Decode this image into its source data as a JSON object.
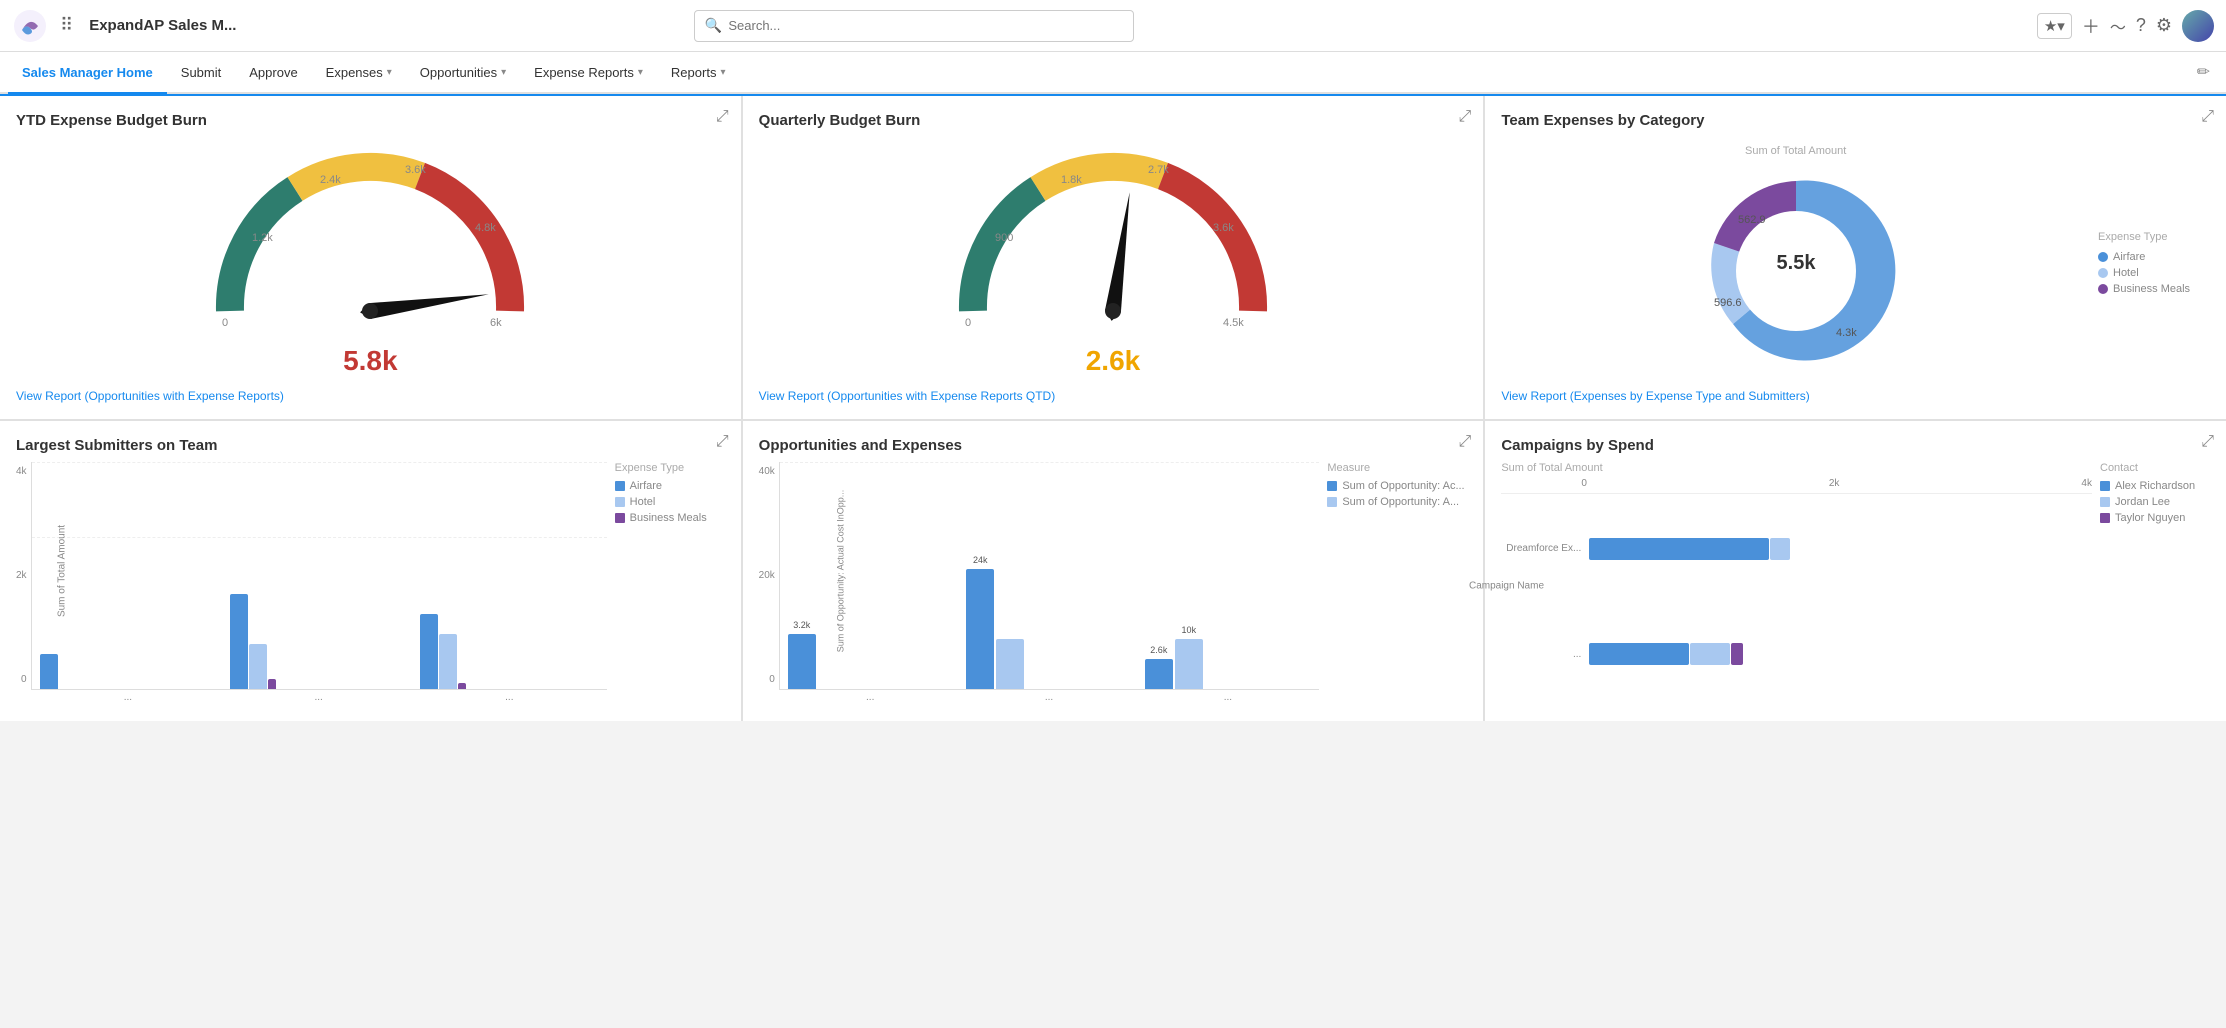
{
  "topbar": {
    "app_name": "ExpandAP Sales M...",
    "search_placeholder": "Search...",
    "edit_icon": "✏"
  },
  "nav": {
    "tabs": [
      {
        "label": "Sales Manager Home",
        "active": true,
        "has_caret": false
      },
      {
        "label": "Submit",
        "active": false,
        "has_caret": false
      },
      {
        "label": "Approve",
        "active": false,
        "has_caret": false
      },
      {
        "label": "Expenses",
        "active": false,
        "has_caret": true
      },
      {
        "label": "Opportunities",
        "active": false,
        "has_caret": true
      },
      {
        "label": "Expense Reports",
        "active": false,
        "has_caret": true
      },
      {
        "label": "Reports",
        "active": false,
        "has_caret": true
      }
    ]
  },
  "widgets": {
    "ytd": {
      "title": "YTD Expense Budget Burn",
      "value": "5.8k",
      "value_color": "red",
      "link": "View Report (Opportunities with Expense Reports)",
      "gauge_labels": [
        "0",
        "1.2k",
        "2.4k",
        "3.6k",
        "4.8k",
        "6k"
      ],
      "needle_angle": 175
    },
    "quarterly": {
      "title": "Quarterly Budget Burn",
      "value": "2.6k",
      "value_color": "yellow",
      "link": "View Report (Opportunities with Expense Reports QTD)",
      "gauge_labels": [
        "0",
        "900",
        "1.8k",
        "2.7k",
        "3.6k",
        "4.5k"
      ],
      "needle_angle": 130
    },
    "team_expenses": {
      "title": "Team Expenses by Category",
      "subtitle": "Sum of Total Amount",
      "center_value": "5.5k",
      "link": "View Report (Expenses by Expense Type and Submitters)",
      "legend": [
        {
          "label": "Airfare",
          "color": "#4a90d9"
        },
        {
          "label": "Hotel",
          "color": "#a8c8f0"
        },
        {
          "label": "Business Meals",
          "color": "#7b4a9e"
        }
      ],
      "segments": [
        {
          "value": 4300,
          "label": "4.3k",
          "color": "#4a90d9",
          "angle": 200
        },
        {
          "value": 596.6,
          "label": "596.6",
          "color": "#a8c8f0",
          "angle": 50
        },
        {
          "value": 562.9,
          "label": "562.9",
          "color": "#7b4a9e",
          "angle": 20
        }
      ]
    },
    "submitters": {
      "title": "Largest Submitters on Team",
      "y_axis_label": "Sum of Total Amount",
      "y_labels": [
        "4k",
        "2k",
        "0"
      ],
      "legend": [
        {
          "label": "Airfare",
          "color": "#4a90d9"
        },
        {
          "label": "Hotel",
          "color": "#a8c8f0"
        },
        {
          "label": "Business Meals",
          "color": "#7b4a9e"
        }
      ],
      "bars": [
        {
          "x_label": "...",
          "airfare": 40,
          "hotel": 0,
          "meals": 0
        },
        {
          "x_label": "...",
          "airfare": 100,
          "hotel": 50,
          "meals": 10
        },
        {
          "x_label": "...",
          "airfare": 80,
          "hotel": 60,
          "meals": 5
        }
      ],
      "expense_type_label": "Expense Type"
    },
    "opportunities": {
      "title": "Opportunities and Expenses",
      "y_axis_label": "Sum of Opportunity: Actual Cost InOpp...",
      "y_labels": [
        "40k",
        "20k",
        "0"
      ],
      "x_labels": [
        "...",
        "..."
      ],
      "legend": [
        {
          "label": "Sum of Opportunity: Ac...",
          "color": "#4a90d9"
        },
        {
          "label": "Sum of Opportunity: A...",
          "color": "#a8c8f0"
        }
      ],
      "bars": [
        {
          "label": "...",
          "val1_h": 60,
          "val2_h": 0,
          "val1_text": "3.2k"
        },
        {
          "label": "...",
          "val1_h": 100,
          "val2_h": 42,
          "val1_text": "24k",
          "val2_text": ""
        },
        {
          "label": "...",
          "val1_h": 28,
          "val2_h": 42,
          "val1_text": "2.6k",
          "val2_text": "10k"
        }
      ],
      "measure_label": "Measure"
    },
    "campaigns": {
      "title": "Campaigns by Spend",
      "subtitle": "Sum of Total Amount",
      "x_labels": [
        "0",
        "2k",
        "4k"
      ],
      "y_label": "Campaign Name",
      "legend": [
        {
          "label": "Alex Richardson",
          "color": "#4a90d9"
        },
        {
          "label": "Jordan Lee",
          "color": "#a8c8f0"
        },
        {
          "label": "Taylor Nguyen",
          "color": "#7b4a9e"
        }
      ],
      "bars": [
        {
          "label": "Dreamforce Ex...",
          "width1": 180,
          "width2": 20,
          "width3": 0
        }
      ],
      "contact_label": "Contact"
    }
  }
}
